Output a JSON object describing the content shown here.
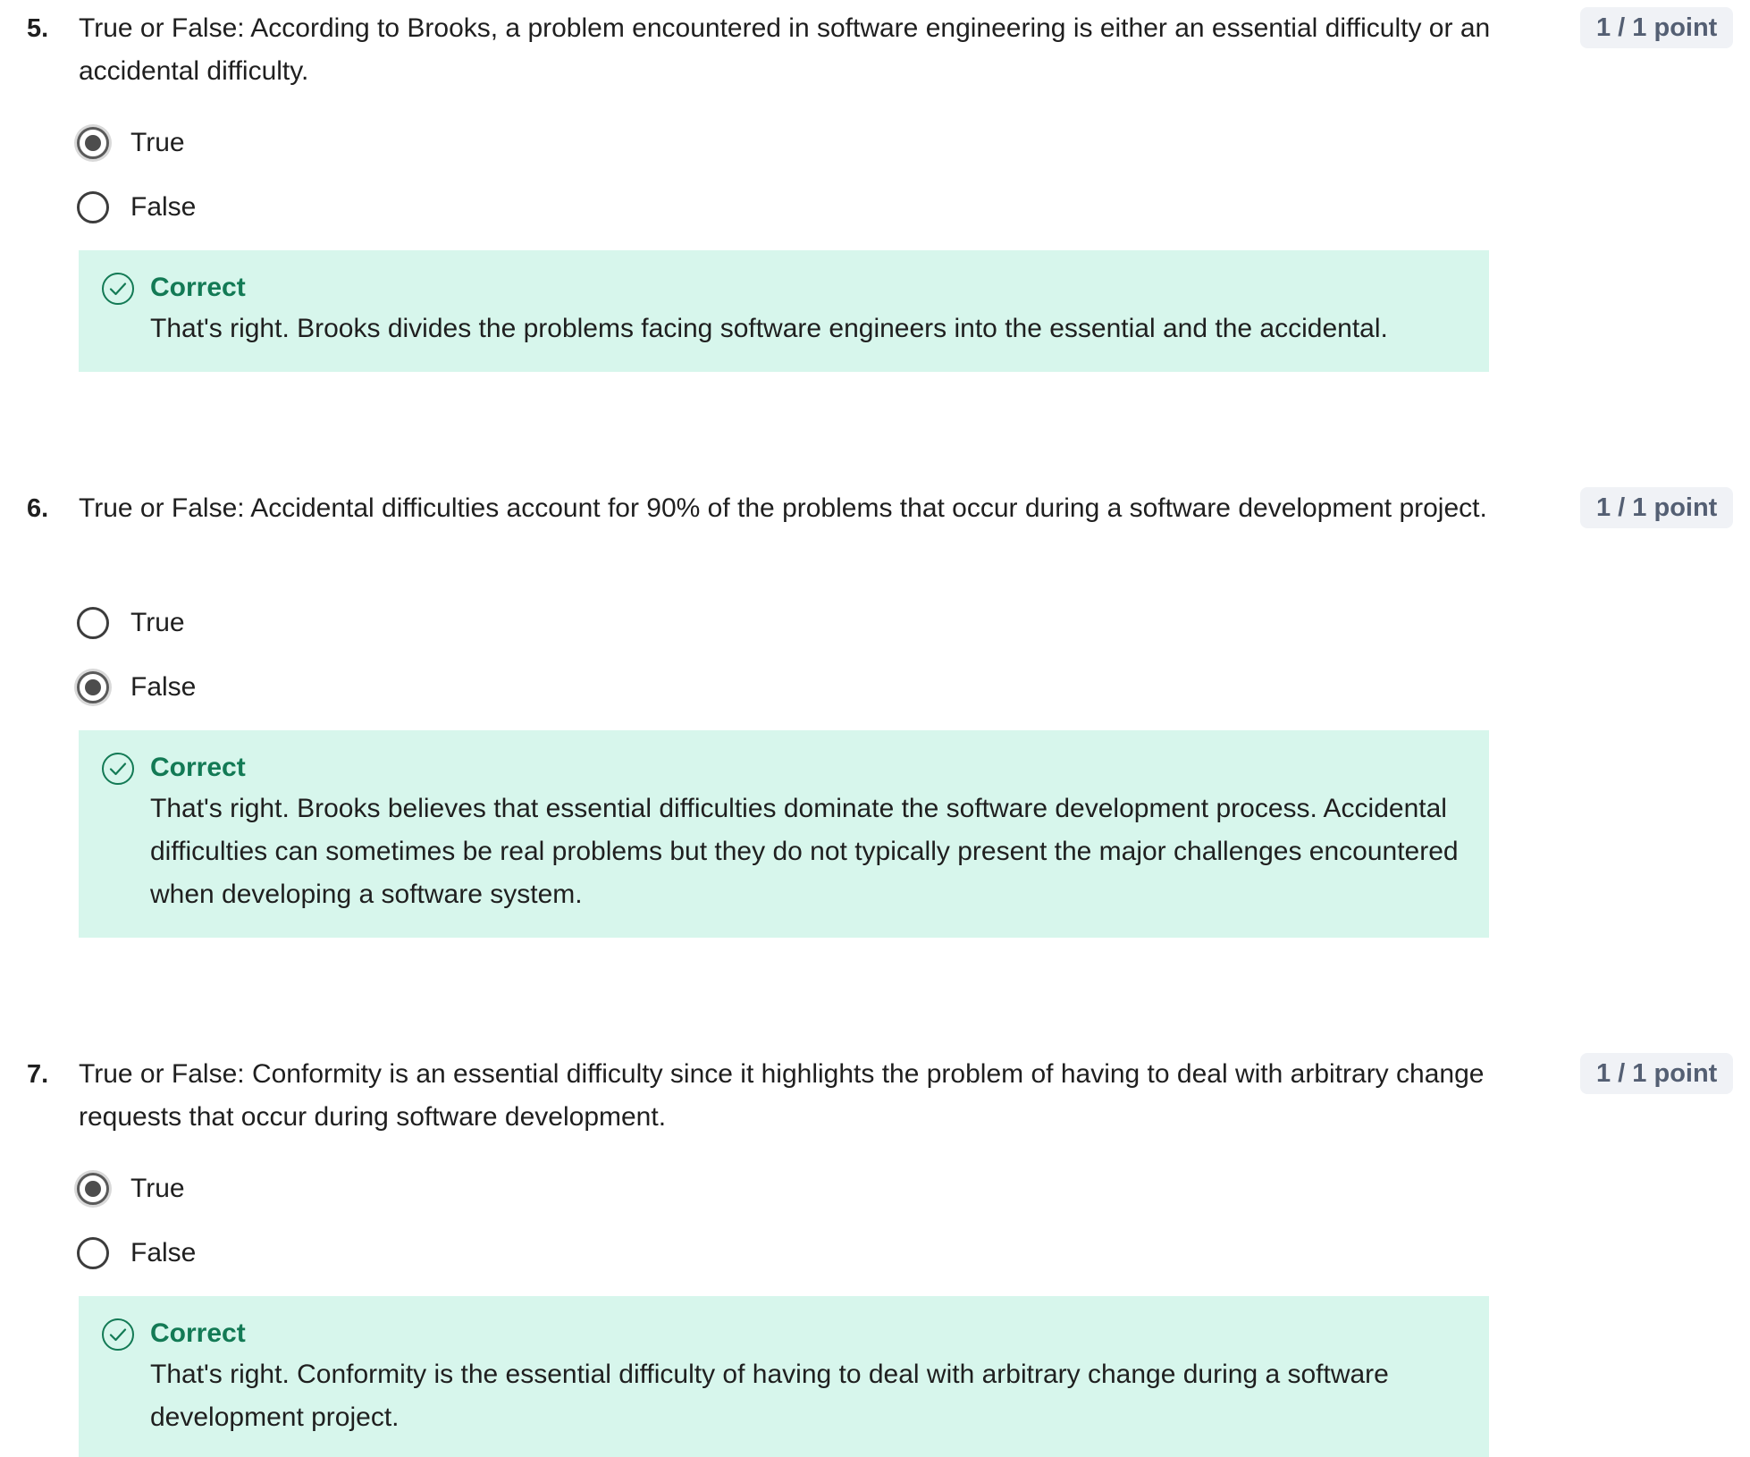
{
  "questions": [
    {
      "number": "5.",
      "text": "True or False: According to Brooks, a problem encountered in software engineering is either an essential difficulty or an accidental difficulty.",
      "points": "1 / 1 point",
      "options": [
        {
          "label": "True",
          "selected": true
        },
        {
          "label": "False",
          "selected": false
        }
      ],
      "feedback": {
        "title": "Correct",
        "text": "That's right. Brooks divides the problems facing software engineers into the essential and the accidental."
      }
    },
    {
      "number": "6.",
      "text": "True or False: Accidental difficulties account for 90% of the problems that occur during a software development project.",
      "points": "1 / 1 point",
      "options": [
        {
          "label": "True",
          "selected": false
        },
        {
          "label": "False",
          "selected": true
        }
      ],
      "feedback": {
        "title": "Correct",
        "text": "That's right. Brooks believes that essential difficulties dominate the software development process. Accidental difficulties can sometimes be real problems but they do not typically present the major challenges encountered when developing a software system."
      }
    },
    {
      "number": "7.",
      "text": "True or False: Conformity is an essential difficulty since it highlights the problem of having to deal with arbitrary change requests that occur during software development.",
      "points": "1 / 1 point",
      "options": [
        {
          "label": "True",
          "selected": true
        },
        {
          "label": "False",
          "selected": false
        }
      ],
      "feedback": {
        "title": "Correct",
        "text": "That's right. Conformity is the essential difficulty of having to deal with arbitrary change during a software development project."
      }
    }
  ],
  "colors": {
    "feedback_bg": "#d7f6ec",
    "correct_green": "#137a55",
    "points_bg": "#f0f2f6",
    "points_text": "#545f73"
  },
  "icons": {
    "correct": "check-circle-icon"
  }
}
